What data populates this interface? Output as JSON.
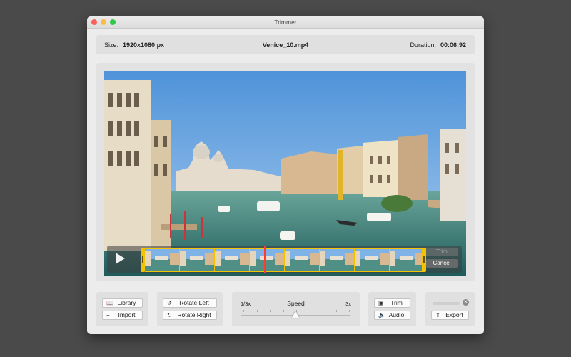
{
  "window": {
    "title": "Trimmer"
  },
  "info": {
    "size_label": "Size:",
    "size_value": "1920x1080 px",
    "filename": "Venice_10.mp4",
    "duration_label": "Duration:",
    "duration_value": "00:06:92"
  },
  "trim_overlay": {
    "trim_label": "Trim",
    "cancel_label": "Cancel"
  },
  "toolbar": {
    "library_label": "Library",
    "import_label": "Import",
    "rotate_left_label": "Rotate Left",
    "rotate_right_label": "Rotate Right",
    "speed_label": "Speed",
    "speed_min_label": "1/3x",
    "speed_max_label": "3x",
    "speed_value_fraction": 0.5,
    "trim_label": "Trim",
    "audio_label": "Audio",
    "export_label": "Export",
    "export_progress_fraction": 0.0
  },
  "icons": {
    "library": "book-icon",
    "import": "plus-icon",
    "rotate_left": "rotate-left-icon",
    "rotate_right": "rotate-right-icon",
    "trim": "trim-icon",
    "audio": "speaker-icon",
    "export": "share-icon",
    "cancel_export": "close-circle-icon",
    "play": "play-icon"
  },
  "colors": {
    "trim_accent": "#f3c300",
    "playhead": "#ff3b30"
  }
}
